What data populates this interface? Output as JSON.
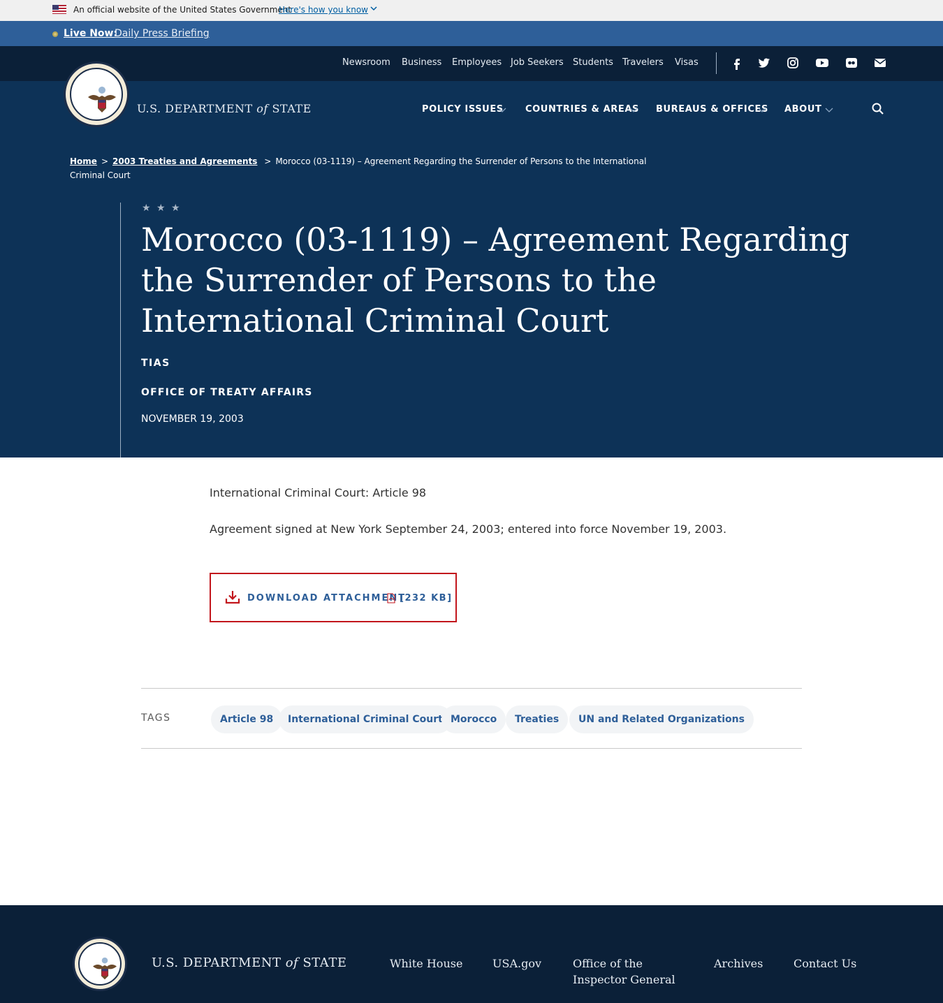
{
  "gov_banner": {
    "text": "An official website of the United States Government",
    "link": "Here's how you know"
  },
  "live": {
    "label": "Live Now:",
    "link": "Daily Press Briefing"
  },
  "topnav": {
    "items": [
      "Newsroom",
      "Business",
      "Employees",
      "Job Seekers",
      "Students",
      "Travelers",
      "Visas"
    ],
    "social": [
      "facebook-icon",
      "twitter-icon",
      "instagram-icon",
      "youtube-icon",
      "flickr-icon",
      "email-icon"
    ]
  },
  "brand": {
    "prefix": "U.S. DEPARTMENT",
    "of": "of",
    "suffix": "STATE"
  },
  "mainnav": {
    "items": [
      "POLICY ISSUES",
      "COUNTRIES & AREAS",
      "BUREAUS & OFFICES",
      "ABOUT"
    ]
  },
  "breadcrumb": {
    "home": "Home",
    "section": "2003 Treaties and Agreements",
    "current": "Morocco (03-1119) – Agreement Regarding the Surrender of Persons to the International Criminal Court"
  },
  "hero": {
    "stars": "★ ★ ★",
    "title": "Morocco (03-1119) – Agreement Regarding the Surrender of Persons to the International Criminal Court",
    "kicker": "TIAS",
    "office": "OFFICE OF TREATY AFFAIRS",
    "date": "NOVEMBER 19, 2003"
  },
  "content": {
    "p1": "International Criminal Court: Article 98",
    "p2": "Agreement signed at New York September 24, 2003; entered into force November 19, 2003."
  },
  "download": {
    "label": "DOWNLOAD ATTACHMENT",
    "size": "[232 KB]"
  },
  "tags": {
    "label": "TAGS",
    "items": [
      "Article 98",
      "International Criminal Court",
      "Morocco",
      "Treaties",
      "UN and Related Organizations"
    ]
  },
  "footer": {
    "links": [
      "White House",
      "USA.gov",
      "Office of the Inspector General",
      "Archives",
      "Contact Us"
    ]
  },
  "colors": {
    "hero_bg": "#0d3257",
    "topnav_bg": "#0b2038",
    "live_bg": "#2e5f99",
    "accent_red": "#c2161c",
    "link_blue": "#2e5f99"
  }
}
